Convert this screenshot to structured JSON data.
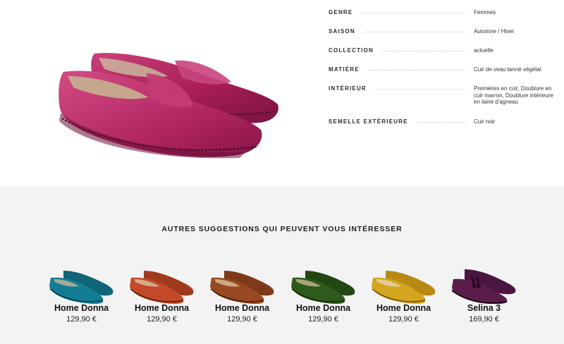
{
  "details": {
    "rows": [
      {
        "label": "GENRE",
        "value": "Femmes"
      },
      {
        "label": "SAISON",
        "value": "Automne / Hiver"
      },
      {
        "label": "COLLECTION",
        "value": "actuelle"
      },
      {
        "label": "MATIÈRE",
        "value": "Cuir de veau tanné végétal"
      },
      {
        "label": "INTÉRIEUR",
        "value": "Premières en cuir, Doublure en cuir marron, Doublure intérieure en laine d'agneau"
      },
      {
        "label": "SEMELLE EXTÉRIEURE",
        "value": "Cuir noir"
      }
    ]
  },
  "hero": {
    "icon": "magenta-loafer-pair-image",
    "color": "#b0245e"
  },
  "suggestions": {
    "title": "AUTRES SUGGESTIONS QUI PEUVENT VOUS INTÉRESSER",
    "items": [
      {
        "name": "Home Donna",
        "price": "129,90 €",
        "color": "#137e93",
        "icon": "teal-loafer-image"
      },
      {
        "name": "Home Donna",
        "price": "129,90 €",
        "color": "#c24a28",
        "icon": "orange-loafer-image"
      },
      {
        "name": "Home Donna",
        "price": "129,90 €",
        "color": "#9a4a22",
        "icon": "brown-loafer-image"
      },
      {
        "name": "Home Donna",
        "price": "129,90 €",
        "color": "#2e5a1c",
        "icon": "green-loafer-image"
      },
      {
        "name": "Home Donna",
        "price": "129,90 €",
        "color": "#d4a521",
        "icon": "yellow-loafer-image"
      },
      {
        "name": "Selina 3",
        "price": "169,90 €",
        "color": "#5a1d49",
        "icon": "purple-tassel-brogue-image"
      }
    ]
  }
}
